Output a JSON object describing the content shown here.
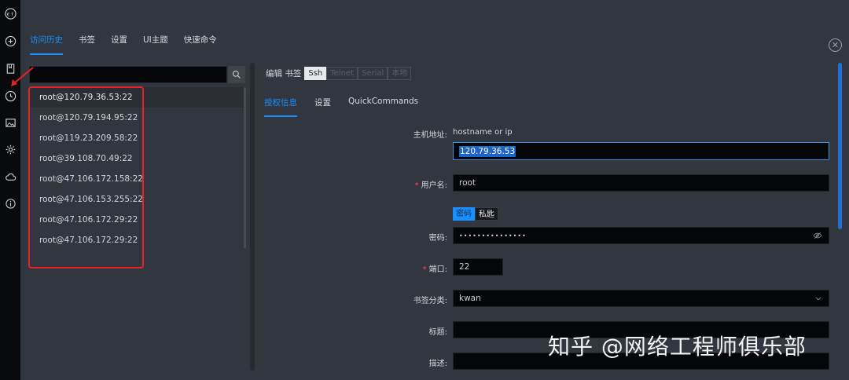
{
  "top_tabs": [
    "访问历史",
    "书签",
    "设置",
    "UI主题",
    "快速命令"
  ],
  "history": {
    "search_placeholder": "",
    "items": [
      "root@120.79.36.53:22",
      "root@120.79.194.95:22",
      "root@119.23.209.58:22",
      "root@39.108.70.49:22",
      "root@47.106.172.158:22",
      "root@47.106.153.255:22",
      "root@47.106.172.29:22",
      "root@47.106.172.29:22"
    ]
  },
  "edit": {
    "label": "编辑 书签",
    "protocols": [
      "Ssh",
      "Telnet",
      "Serial",
      "本地"
    ],
    "sub_tabs": [
      "授权信息",
      "设置",
      "QuickCommands"
    ]
  },
  "form": {
    "host_label": "主机地址:",
    "host_hint": "hostname or ip",
    "host_value": "120.79.36.53",
    "user_label": "用户名:",
    "user_value": "root",
    "auth_options": [
      "密码",
      "私匙"
    ],
    "password_label": "密码:",
    "password_value": "•••••••••••••••",
    "port_label": "端口:",
    "port_value": "22",
    "category_label": "书签分类:",
    "category_value": "kwan",
    "title_label": "标题:",
    "title_value": "",
    "desc_label": "描述:",
    "desc_value": ""
  },
  "watermark": "知乎 @网络工程师俱乐部",
  "colors": {
    "accent": "#1890ff",
    "annotation": "#e3242b",
    "rail": "#090a0c",
    "background": "#32363e"
  },
  "icons": [
    "app-logo-icon",
    "plus-circle-icon",
    "bookmark-icon",
    "clock-icon",
    "image-icon",
    "gear-icon",
    "cloud-sync-icon",
    "info-icon",
    "search-icon",
    "close-icon",
    "eye-icon",
    "chevron-down-icon"
  ]
}
